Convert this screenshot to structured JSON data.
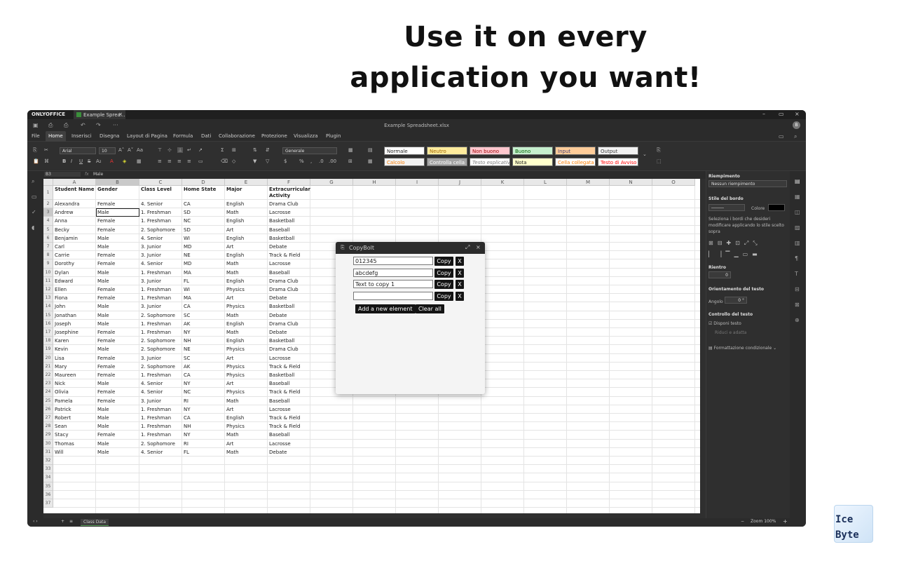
{
  "headline": {
    "line1": "Use it on every",
    "line2": "application you want!"
  },
  "window": {
    "brand": "ONLYOFFICE",
    "tab_title": "Example Sprea...",
    "file_title": "Example Spreadsheet.xlsx",
    "avatar": "B",
    "minimize": "–",
    "restore": "▭",
    "close": "×"
  },
  "menu": [
    "File",
    "Home",
    "Inserisci",
    "Disegna",
    "Layout di Pagina",
    "Formula",
    "Dati",
    "Collaborazione",
    "Protezione",
    "Visualizza",
    "Plugin"
  ],
  "toolbar": {
    "font": "Arial",
    "size": "10",
    "format": "Generale",
    "styles_row1": [
      "Normale",
      "Neutro",
      "Non buono",
      "Buono",
      "Input",
      "Output"
    ],
    "styles_row2": [
      "Calcolo",
      "Controlla cella",
      "Testo esplicativo",
      "Nota",
      "Cella collegata",
      "Testo di Avviso"
    ]
  },
  "formula": {
    "cell_ref": "B3",
    "fx": "fx",
    "value": "Male"
  },
  "sheet": {
    "columns": [
      "A",
      "B",
      "C",
      "D",
      "E",
      "F",
      "G",
      "H",
      "I",
      "J",
      "K",
      "L",
      "M",
      "N",
      "O"
    ],
    "headers": [
      "Student Name",
      "Gender",
      "Class Level",
      "Home State",
      "Major",
      "Extracurricular Activity"
    ],
    "rows": [
      [
        "Alexandra",
        "Female",
        "4. Senior",
        "CA",
        "English",
        "Drama Club"
      ],
      [
        "Andrew",
        "Male",
        "1. Freshman",
        "SD",
        "Math",
        "Lacrosse"
      ],
      [
        "Anna",
        "Female",
        "1. Freshman",
        "NC",
        "English",
        "Basketball"
      ],
      [
        "Becky",
        "Female",
        "2. Sophomore",
        "SD",
        "Art",
        "Baseball"
      ],
      [
        "Benjamin",
        "Male",
        "4. Senior",
        "WI",
        "English",
        "Basketball"
      ],
      [
        "Carl",
        "Male",
        "3. Junior",
        "MD",
        "Art",
        "Debate"
      ],
      [
        "Carrie",
        "Female",
        "3. Junior",
        "NE",
        "English",
        "Track & Field"
      ],
      [
        "Dorothy",
        "Female",
        "4. Senior",
        "MD",
        "Math",
        "Lacrosse"
      ],
      [
        "Dylan",
        "Male",
        "1. Freshman",
        "MA",
        "Math",
        "Baseball"
      ],
      [
        "Edward",
        "Male",
        "3. Junior",
        "FL",
        "English",
        "Drama Club"
      ],
      [
        "Ellen",
        "Female",
        "1. Freshman",
        "WI",
        "Physics",
        "Drama Club"
      ],
      [
        "Fiona",
        "Female",
        "1. Freshman",
        "MA",
        "Art",
        "Debate"
      ],
      [
        "John",
        "Male",
        "3. Junior",
        "CA",
        "Physics",
        "Basketball"
      ],
      [
        "Jonathan",
        "Male",
        "2. Sophomore",
        "SC",
        "Math",
        "Debate"
      ],
      [
        "Joseph",
        "Male",
        "1. Freshman",
        "AK",
        "English",
        "Drama Club"
      ],
      [
        "Josephine",
        "Female",
        "1. Freshman",
        "NY",
        "Math",
        "Debate"
      ],
      [
        "Karen",
        "Female",
        "2. Sophomore",
        "NH",
        "English",
        "Basketball"
      ],
      [
        "Kevin",
        "Male",
        "2. Sophomore",
        "NE",
        "Physics",
        "Drama Club"
      ],
      [
        "Lisa",
        "Female",
        "3. Junior",
        "SC",
        "Art",
        "Lacrosse"
      ],
      [
        "Mary",
        "Female",
        "2. Sophomore",
        "AK",
        "Physics",
        "Track & Field"
      ],
      [
        "Maureen",
        "Female",
        "1. Freshman",
        "CA",
        "Physics",
        "Basketball"
      ],
      [
        "Nick",
        "Male",
        "4. Senior",
        "NY",
        "Art",
        "Baseball"
      ],
      [
        "Olivia",
        "Female",
        "4. Senior",
        "NC",
        "Physics",
        "Track & Field"
      ],
      [
        "Pamela",
        "Female",
        "3. Junior",
        "RI",
        "Math",
        "Baseball"
      ],
      [
        "Patrick",
        "Male",
        "1. Freshman",
        "NY",
        "Art",
        "Lacrosse"
      ],
      [
        "Robert",
        "Male",
        "1. Freshman",
        "CA",
        "English",
        "Track & Field"
      ],
      [
        "Sean",
        "Male",
        "1. Freshman",
        "NH",
        "Physics",
        "Track & Field"
      ],
      [
        "Stacy",
        "Female",
        "1. Freshman",
        "NY",
        "Math",
        "Baseball"
      ],
      [
        "Thomas",
        "Male",
        "2. Sophomore",
        "RI",
        "Art",
        "Lacrosse"
      ],
      [
        "Will",
        "Male",
        "4. Senior",
        "FL",
        "Math",
        "Debate"
      ]
    ],
    "total_rows": 37
  },
  "right_panel": {
    "fill_title": "Riempimento",
    "fill_value": "Nessun riempimento",
    "border_title": "Stile del bordo",
    "color_label": "Colore",
    "border_hint": "Seleziona i bordi che desideri modificare applicando lo stile scelto sopra",
    "indent_title": "Rientro",
    "indent_value": "0",
    "orientation_title": "Orientamento del testo",
    "angle_label": "Angolo",
    "angle_value": "0 °",
    "control_title": "Controllo del testo",
    "wrap_label": "Disponi testo",
    "shrink_label": "Riduci e adatta",
    "conditional_label": "Formattazione condizionale"
  },
  "status": {
    "sheet_tab": "Class Data",
    "zoom": "Zoom 100%"
  },
  "popup": {
    "title": "CopyBolt",
    "items": [
      {
        "value": "012345",
        "copy": "Copy",
        "remove": "X"
      },
      {
        "value": "abcdefg",
        "copy": "Copy",
        "remove": "X"
      },
      {
        "value": "Text to copy 1",
        "copy": "Copy",
        "remove": "X"
      },
      {
        "value": "",
        "copy": "Copy",
        "remove": "X"
      }
    ],
    "add_label": "Add a new element",
    "clear_label": "Clear all"
  },
  "logo": {
    "line1": "Ice",
    "line2": "Byte"
  }
}
